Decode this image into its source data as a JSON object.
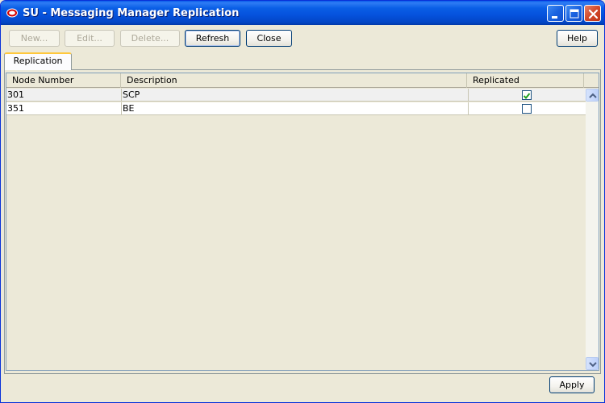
{
  "window": {
    "title": "SU - Messaging Manager Replication"
  },
  "toolbar": {
    "new_label": "New...",
    "edit_label": "Edit...",
    "delete_label": "Delete...",
    "refresh_label": "Refresh",
    "close_label": "Close",
    "help_label": "Help"
  },
  "tabs": [
    {
      "label": "Replication"
    }
  ],
  "table": {
    "columns": [
      "Node Number",
      "Description",
      "Replicated"
    ],
    "rows": [
      {
        "node": "301",
        "description": "SCP",
        "replicated": true
      },
      {
        "node": "351",
        "description": "BE",
        "replicated": false
      }
    ]
  },
  "footer": {
    "apply_label": "Apply"
  },
  "colors": {
    "titlebar": "#0551dc",
    "tab_accent": "#ffc83c",
    "checkmark": "#21a121"
  }
}
